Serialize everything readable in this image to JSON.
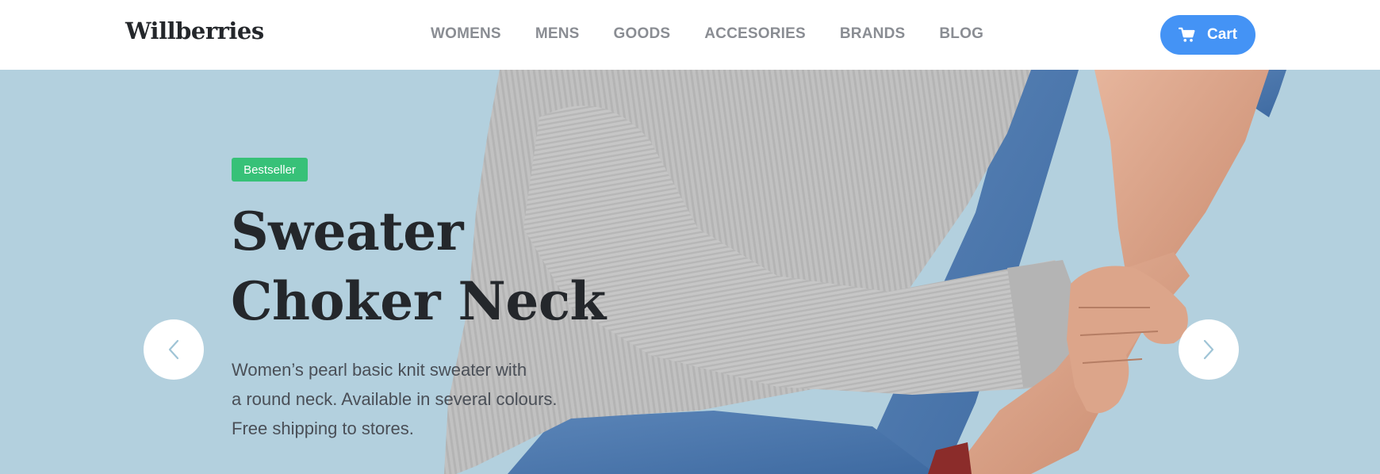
{
  "header": {
    "logo": "Willberries",
    "nav": [
      "WOMENS",
      "MENS",
      "GOODS",
      "ACCESORIES",
      "BRANDS",
      "BLOG"
    ],
    "cart_label": "Cart"
  },
  "hero": {
    "badge": "Bestseller",
    "title_line1": "Sweater",
    "title_line2": "Choker Neck",
    "desc_line1": "Women’s pearl basic knit sweater with",
    "desc_line2": "a round neck. Available in several colours.",
    "desc_line3": "Free shipping to stores."
  },
  "colors": {
    "accent": "#4493f5",
    "badge": "#37c178",
    "hero_bg": "#b3d0de"
  },
  "icons": {
    "cart": "cart-icon",
    "prev": "chevron-left-icon",
    "next": "chevron-right-icon"
  }
}
